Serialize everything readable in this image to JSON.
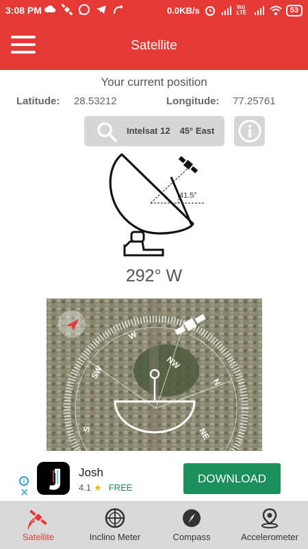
{
  "statusbar": {
    "time": "3:08 PM",
    "network_speed": "0.0KB/s",
    "battery": "53",
    "carrier": "Vo) LTE"
  },
  "appbar": {
    "title": "Satellite"
  },
  "position": {
    "title": "Your current position",
    "latitude_label": "Latitude:",
    "latitude_value": "28.53212",
    "longitude_label": "Longitude:",
    "longitude_value": "77.25761"
  },
  "satellite": {
    "name": "Intelsat 12",
    "orbit": "45° East"
  },
  "dish": {
    "elevation": "41.5°"
  },
  "azimuth": "292° W",
  "compass": {
    "labels": [
      "W",
      "NW",
      "N",
      "NE",
      "SW",
      "S"
    ]
  },
  "ad": {
    "app_name": "Josh",
    "rating": "4.1",
    "price": "FREE",
    "cta": "DOWNLOAD"
  },
  "bottom_nav": [
    {
      "label": "Satellite",
      "icon": "satellite-icon",
      "active": true
    },
    {
      "label": "Inclino Meter",
      "icon": "inclinometer-icon",
      "active": false
    },
    {
      "label": "Compass",
      "icon": "compass-icon",
      "active": false
    },
    {
      "label": "Accelerometer",
      "icon": "location-pin-icon",
      "active": false
    }
  ],
  "colors": {
    "accent": "#e53935",
    "download": "#1a8f5a",
    "nav_bg": "#d9d9d9"
  }
}
